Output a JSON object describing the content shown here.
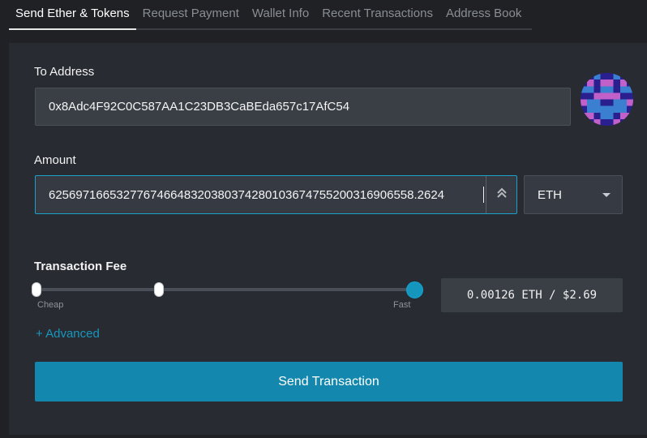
{
  "tabs": [
    {
      "label": "Send Ether & Tokens",
      "active": true
    },
    {
      "label": "Request Payment"
    },
    {
      "label": "Wallet Info"
    },
    {
      "label": "Recent Transactions"
    },
    {
      "label": "Address Book"
    }
  ],
  "to_address": {
    "label": "To Address",
    "value": "0x8Adc4F92C0C587AA1C23DB3CaBEda657c17AfC54",
    "identicon": "address-identicon"
  },
  "amount": {
    "label": "Amount",
    "value": "6256971665327767466483203803742801036747552003169065​58.2624",
    "display_value": "625697166532776746648320380374280103674755200316906558.2624",
    "currency": "ETH",
    "toggle_icon": "double-chevron-up-icon"
  },
  "fee": {
    "label": "Transaction Fee",
    "slider_left_label": "Cheap",
    "slider_right_label": "Fast",
    "slider_level": 1.0,
    "value_text": "0.00126 ETH / $2.69",
    "advanced_label": "+ Advanced"
  },
  "send_button": "Send Transaction",
  "colors": {
    "accent": "#1387ad",
    "background": "#1f2125",
    "panel": "#282c32"
  }
}
